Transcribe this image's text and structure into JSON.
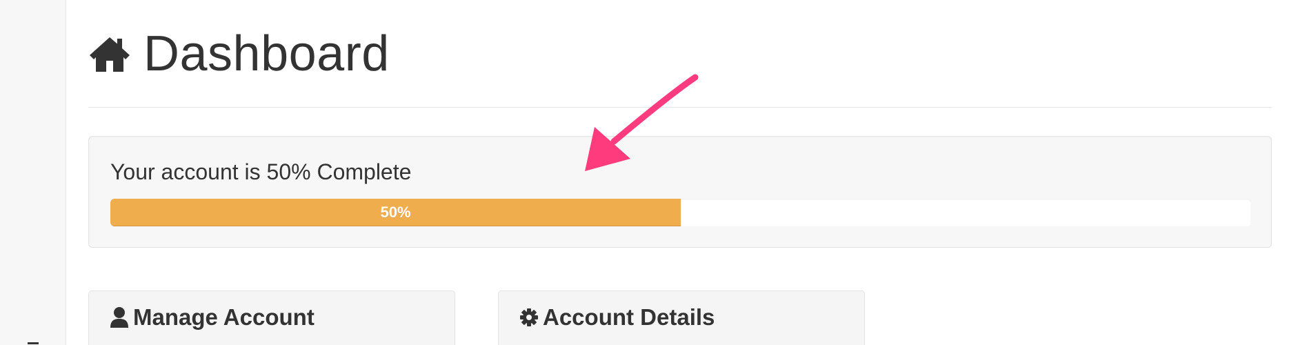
{
  "header": {
    "title": "Dashboard",
    "icon": "home-icon"
  },
  "account_progress": {
    "status_text": "Your account is 50% Complete",
    "percent": 50,
    "bar_label": "50%",
    "bar_color": "#f0ad4e"
  },
  "panels": [
    {
      "title": "Manage Account",
      "icon": "user-icon"
    },
    {
      "title": "Account Details",
      "icon": "gear-icon"
    }
  ],
  "annotation": {
    "arrow_color": "#fe3b7d"
  }
}
